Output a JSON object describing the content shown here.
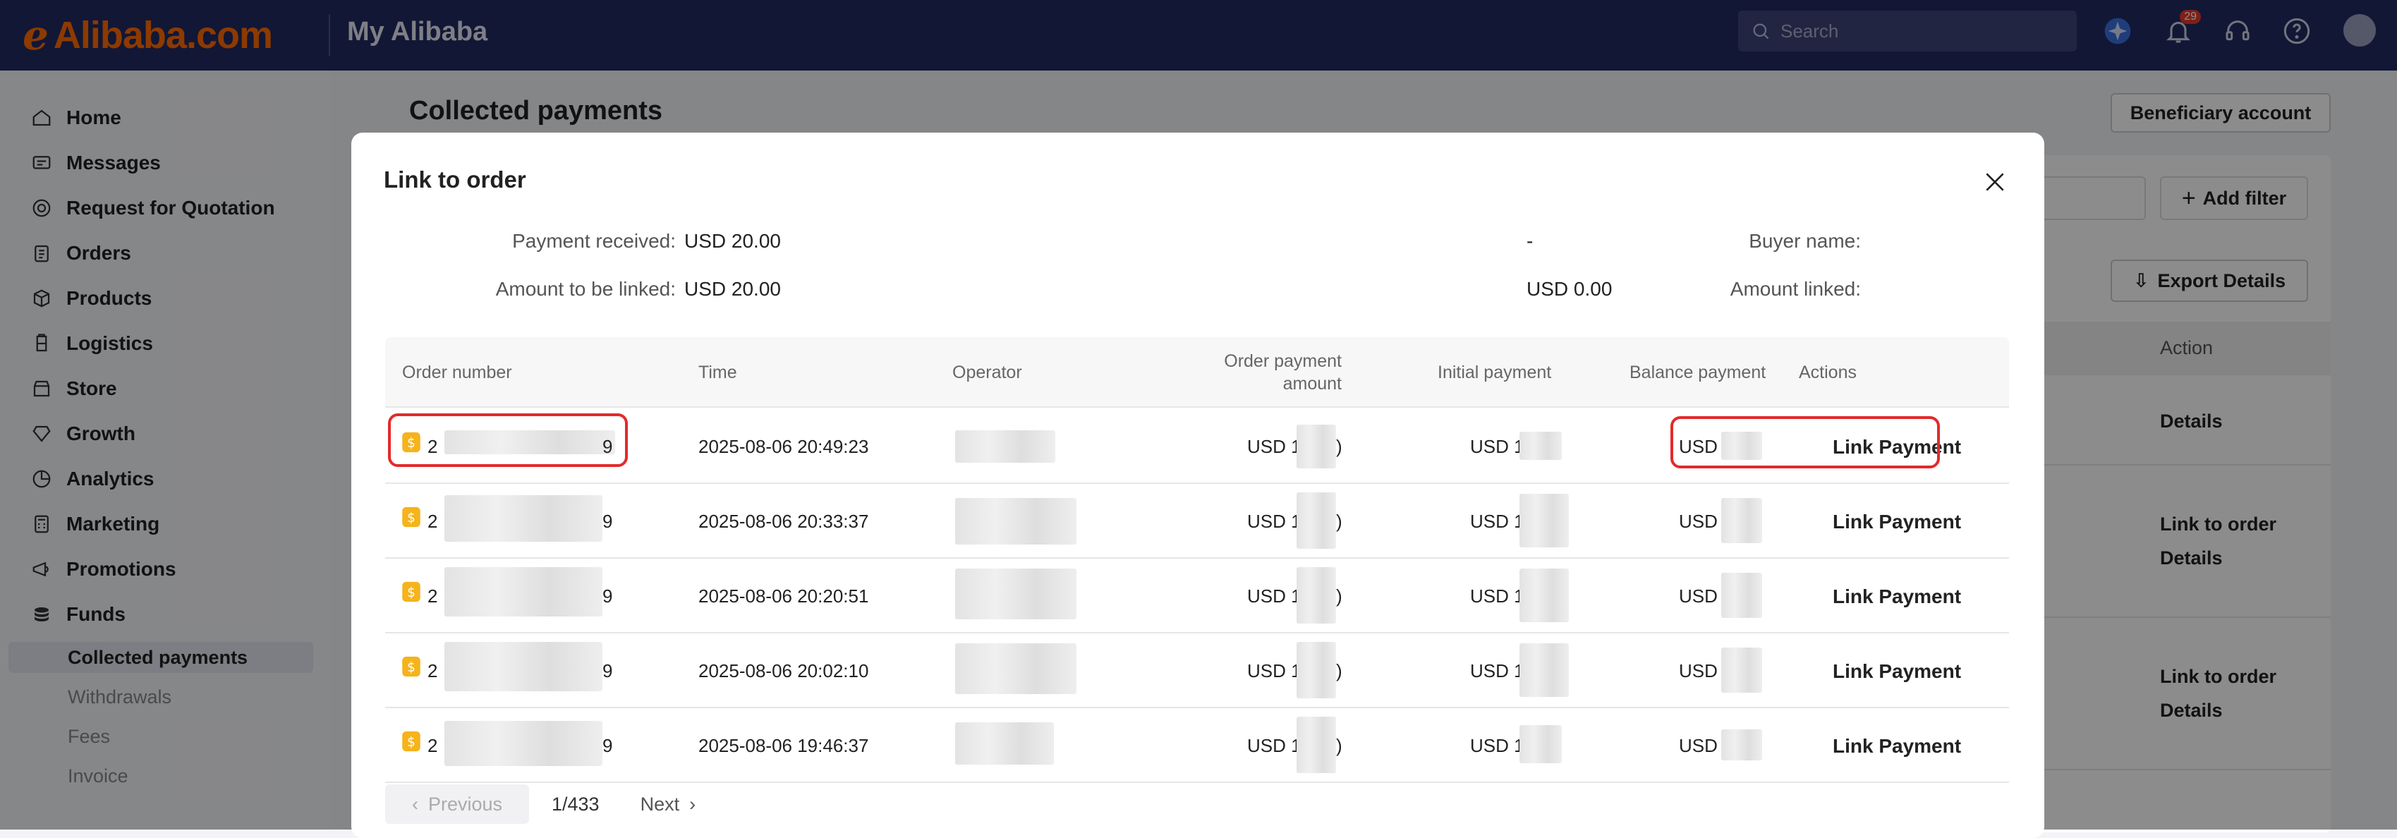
{
  "header": {
    "logo_text": "Alibaba.com",
    "section_title": "My Alibaba",
    "search_placeholder": "Search",
    "notification_count": "29"
  },
  "sidebar": {
    "items": [
      {
        "label": "Home",
        "icon": "home-icon"
      },
      {
        "label": "Messages",
        "icon": "message-icon"
      },
      {
        "label": "Request for Quotation",
        "icon": "target-icon"
      },
      {
        "label": "Orders",
        "icon": "clipboard-icon"
      },
      {
        "label": "Products",
        "icon": "cube-icon"
      },
      {
        "label": "Logistics",
        "icon": "truck-icon"
      },
      {
        "label": "Store",
        "icon": "store-icon"
      },
      {
        "label": "Growth",
        "icon": "diamond-icon"
      },
      {
        "label": "Analytics",
        "icon": "pie-chart-icon"
      },
      {
        "label": "Marketing",
        "icon": "calculator-icon"
      },
      {
        "label": "Promotions",
        "icon": "megaphone-icon"
      },
      {
        "label": "Funds",
        "icon": "coins-icon"
      }
    ],
    "sub_items": [
      "Collected payments",
      "Withdrawals",
      "Fees",
      "Invoice"
    ],
    "active_sub": "Collected payments"
  },
  "page": {
    "title": "Collected payments",
    "beneficiary_button": "Beneficiary account",
    "add_filter": "Add filter",
    "export_details": "Export Details",
    "action_header": "Action",
    "actions": [
      "Details",
      "Link to order",
      "Details",
      "Link to order",
      "Details"
    ],
    "partial_value": "0"
  },
  "modal": {
    "title": "Link to order",
    "payment_received_label": "Payment received",
    "payment_received_value": "USD 20.00",
    "amount_to_link_label": "Amount to be linked",
    "amount_to_link_value": "USD 20.00",
    "buyer_name_label": "Buyer name",
    "buyer_name_value": "-",
    "amount_linked_label": "Amount linked",
    "amount_linked_value": "USD 0.00",
    "columns": [
      "Order number",
      "Time",
      "Operator",
      "Order payment amount",
      "Initial payment",
      "Balance payment",
      "Actions"
    ],
    "rows": [
      {
        "order_prefix": "2",
        "order_suffix": "9",
        "time": "2025-08-06 20:49:23",
        "order_amount": "USD 1",
        "order_amount_end": ")",
        "initial": "USD 1",
        "balance": "USD",
        "action": "Link Payment"
      },
      {
        "order_prefix": "2",
        "order_suffix": "9",
        "time": "2025-08-06 20:33:37",
        "order_amount": "USD 1",
        "order_amount_end": ")",
        "initial": "USD 1",
        "balance": "USD",
        "action": "Link Payment"
      },
      {
        "order_prefix": "2",
        "order_suffix": "9",
        "time": "2025-08-06 20:20:51",
        "order_amount": "USD 1",
        "order_amount_end": ")",
        "initial": "USD 1",
        "balance": "USD",
        "action": "Link Payment"
      },
      {
        "order_prefix": "2",
        "order_suffix": "9",
        "time": "2025-08-06 20:02:10",
        "order_amount": "USD 1",
        "order_amount_end": ")",
        "initial": "USD 1",
        "balance": "USD",
        "action": "Link Payment"
      },
      {
        "order_prefix": "2",
        "order_suffix": "9",
        "time": "2025-08-06 19:46:37",
        "order_amount": "USD 1",
        "order_amount_end": ")",
        "initial": "USD 1",
        "balance": "USD",
        "action": "Link Payment"
      }
    ],
    "pager": {
      "previous": "Previous",
      "page": "1/433",
      "next": "Next"
    }
  },
  "colors": {
    "topbar": "#222b63",
    "brand_orange": "#ff6a00",
    "highlight_red": "#e32a2a"
  }
}
